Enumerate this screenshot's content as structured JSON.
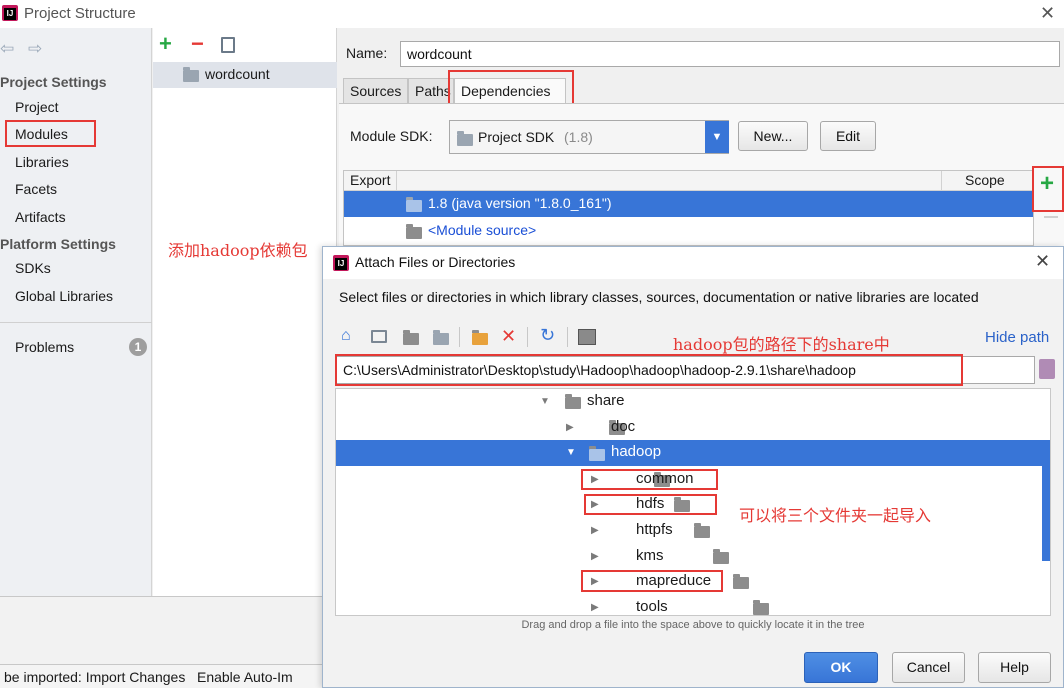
{
  "window": {
    "title": "Project Structure"
  },
  "nav": {
    "project_settings_header": "Project Settings",
    "project_items": [
      "Project",
      "Modules",
      "Libraries",
      "Facets",
      "Artifacts"
    ],
    "platform_settings_header": "Platform Settings",
    "platform_items": [
      "SDKs",
      "Global Libraries"
    ],
    "problems_label": "Problems",
    "problems_count": "1"
  },
  "modules": {
    "items": [
      "wordcount"
    ]
  },
  "module_editor": {
    "name_label": "Name:",
    "name_value": "wordcount",
    "tabs": [
      "Sources",
      "Paths",
      "Dependencies"
    ],
    "sdk_label": "Module SDK:",
    "sdk_value": "Project SDK",
    "sdk_version": "(1.8)",
    "new_button": "New...",
    "edit_button": "Edit",
    "table_headers": {
      "export": "Export",
      "scope": "Scope"
    },
    "rows": [
      "1.8 (java version \"1.8.0_161\")",
      "<Module source>"
    ]
  },
  "annotations": {
    "add_dependency": "添加hadoop依赖包",
    "path_hint": "hadoop包的路径下的share中",
    "folders_hint": "可以将三个文件夹一起导入"
  },
  "bottom_bar": {
    "text": "be imported: Import Changes   Enable Auto-Im"
  },
  "dialog": {
    "title": "Attach Files or Directories",
    "instruction": "Select files or directories in which library classes, sources, documentation or native libraries are located",
    "hide_path": "Hide path",
    "path_value": "C:\\Users\\Administrator\\Desktop\\study\\Hadoop\\hadoop\\hadoop-2.9.1\\share\\hadoop",
    "tree": {
      "root": "share",
      "doc": "doc",
      "hadoop": "hadoop",
      "children": [
        "common",
        "hdfs",
        "httpfs",
        "kms",
        "mapreduce",
        "tools"
      ]
    },
    "hint": "Drag and drop a file into the space above to quickly locate it in the tree",
    "ok_button": "OK",
    "cancel_button": "Cancel",
    "help_button": "Help"
  },
  "colors": {
    "accent_blue": "#3875d7",
    "annotation_red": "#e53935",
    "add_green": "#27a844",
    "remove_red": "#e53935"
  }
}
